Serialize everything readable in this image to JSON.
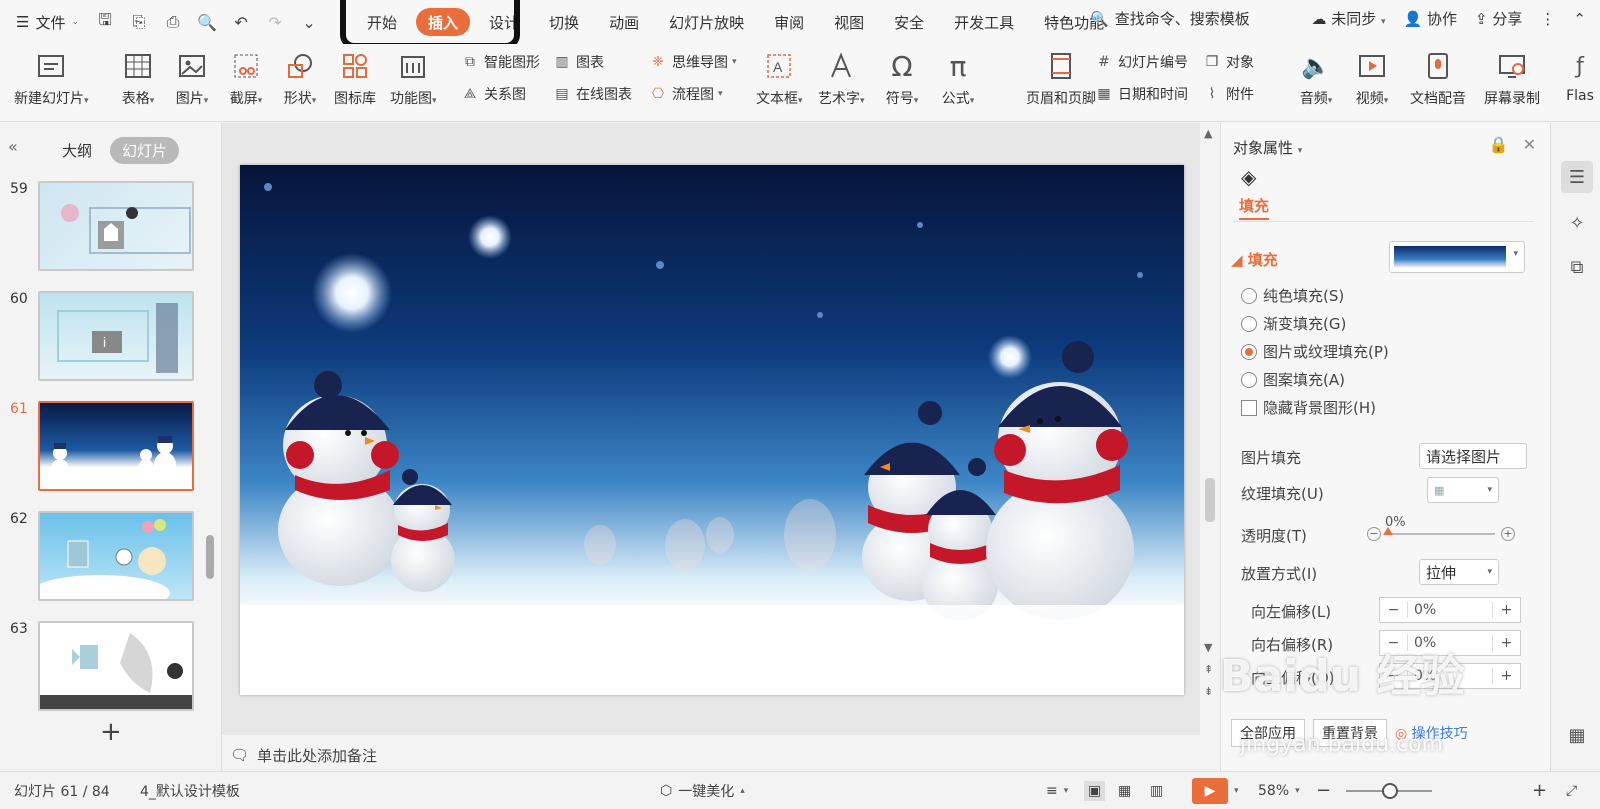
{
  "menubar": {
    "file_label": "文件",
    "tabs": [
      "开始",
      "插入",
      "设计",
      "切换",
      "动画",
      "幻灯片放映",
      "审阅",
      "视图",
      "安全",
      "开发工具",
      "特色功能"
    ],
    "active_tab": "插入",
    "search_placeholder": "查找命令、搜索模板",
    "sync_label": "未同步",
    "collab_label": "协作",
    "share_label": "分享"
  },
  "toolbar": {
    "new_slide": "新建幻灯片",
    "table": "表格",
    "picture": "图片",
    "screenshot": "截屏",
    "shape": "形状",
    "icon_lib": "图标库",
    "func_chart": "功能图",
    "smart_shape": "智能图形",
    "chart": "图表",
    "relation": "关系图",
    "online_chart": "在线图表",
    "mindmap": "思维导图",
    "flowchart": "流程图",
    "textbox": "文本框",
    "wordart": "艺术字",
    "symbol": "符号",
    "formula": "公式",
    "header_footer": "页眉和页脚",
    "slide_number": "幻灯片编号",
    "object": "对象",
    "datetime": "日期和时间",
    "attachment": "附件",
    "audio": "音频",
    "video": "视频",
    "narration": "文档配音",
    "screen_record": "屏幕录制",
    "flash": "Flas"
  },
  "left_panel": {
    "tab_outline": "大纲",
    "tab_slides": "幻灯片",
    "slides": [
      {
        "num": "59"
      },
      {
        "num": "60"
      },
      {
        "num": "61"
      },
      {
        "num": "62"
      },
      {
        "num": "63"
      }
    ],
    "active_slide": "61"
  },
  "notes_placeholder": "单击此处添加备注",
  "right_panel": {
    "title": "对象属性",
    "tab_fill": "填充",
    "section_fill": "填充",
    "fill_options": [
      "纯色填充(S)",
      "渐变填充(G)",
      "图片或纹理填充(P)",
      "图案填充(A)"
    ],
    "selected_option": "图片或纹理填充(P)",
    "hide_bg": "隐藏背景图形(H)",
    "picture_fill_label": "图片填充",
    "picture_fill_value": "请选择图片",
    "texture_fill_label": "纹理填充(U)",
    "transparency_label": "透明度(T)",
    "transparency_value": "0%",
    "placement_label": "放置方式(I)",
    "placement_value": "拉伸",
    "offset_left_label": "向左偏移(L)",
    "offset_left_value": "0%",
    "offset_right_label": "向右偏移(R)",
    "offset_right_value": "0%",
    "offset_up_label": "向上偏移(O)",
    "offset_up_value": "0%",
    "apply_all": "全部应用",
    "reset_bg": "重置背景",
    "tips": "操作技巧"
  },
  "statusbar": {
    "slide_info": "幻灯片 61 / 84",
    "template": "4_默认设计模板",
    "beautify": "一键美化",
    "zoom": "58%"
  },
  "watermark": {
    "brand": "Baidu 经验",
    "url": "jingyan.baidu.com"
  },
  "colors": {
    "accent": "#ea6e3c",
    "highlight_frame": "#111111"
  }
}
